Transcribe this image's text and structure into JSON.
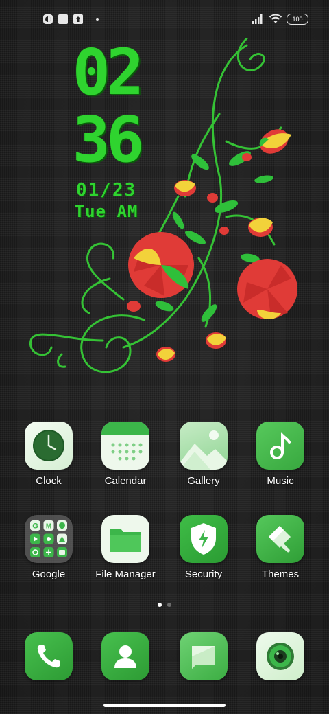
{
  "status_bar": {
    "battery": "100",
    "icons": [
      "notification-app-icon",
      "square-notification-icon",
      "upload-notification-icon",
      "dot-indicator",
      "signal-icon",
      "wifi-icon",
      "battery-icon"
    ]
  },
  "clock": {
    "hours": "02",
    "minutes": "36",
    "date": "01/23",
    "day": "Tue AM",
    "color": "#2fd42f"
  },
  "apps": [
    {
      "label": "Clock",
      "icon": "clock-icon"
    },
    {
      "label": "Calendar",
      "icon": "calendar-icon"
    },
    {
      "label": "Gallery",
      "icon": "gallery-icon"
    },
    {
      "label": "Music",
      "icon": "music-note-icon"
    },
    {
      "label": "Google",
      "icon": "google-folder-icon"
    },
    {
      "label": "File Manager",
      "icon": "folder-icon"
    },
    {
      "label": "Security",
      "icon": "shield-bolt-icon"
    },
    {
      "label": "Themes",
      "icon": "paint-brush-icon"
    }
  ],
  "dock": [
    {
      "name": "Phone",
      "icon": "phone-icon"
    },
    {
      "name": "Contacts",
      "icon": "contact-icon"
    },
    {
      "name": "Messages",
      "icon": "message-icon"
    },
    {
      "name": "Camera",
      "icon": "camera-icon"
    }
  ],
  "page_indicator": {
    "pages": 2,
    "current": 1
  },
  "theme": {
    "accent": "#2fd42f",
    "icon_green": "#3cb64a",
    "icon_light": "#e6f5e6"
  }
}
